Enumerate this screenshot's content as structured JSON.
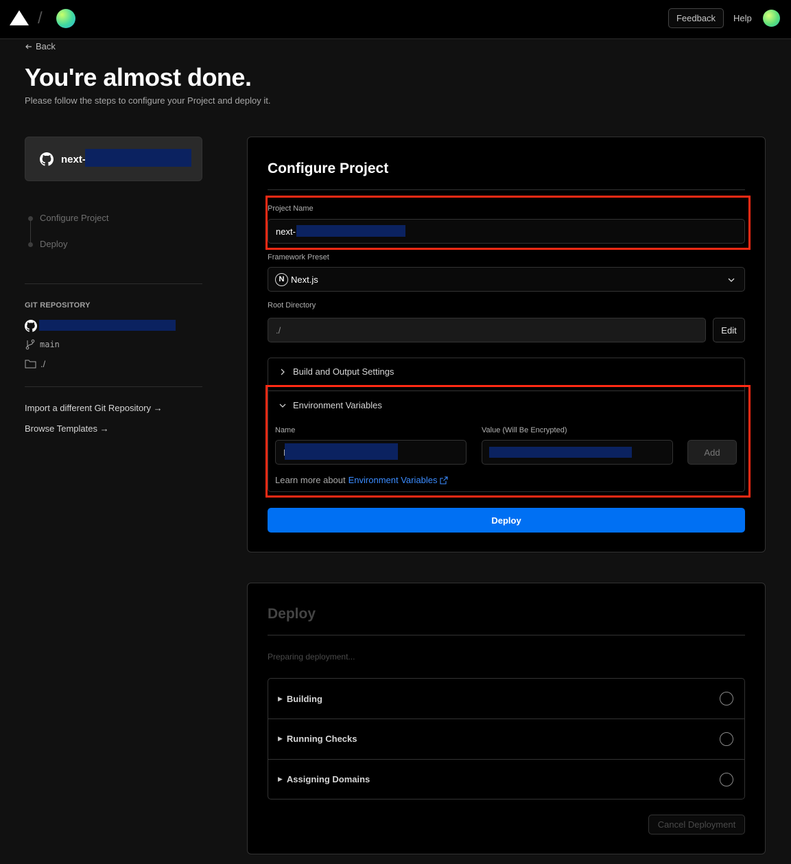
{
  "topbar": {
    "feedback_label": "Feedback",
    "help_label": "Help",
    "logo_icon": "triangle-logo-icon"
  },
  "header": {
    "back_label": "Back",
    "title": "You're almost done.",
    "subtitle": "Please follow the steps to configure your Project and deploy it."
  },
  "sidebar": {
    "repo_card_prefix": "next-",
    "steps": [
      "Configure Project",
      "Deploy"
    ],
    "git_section_label": "GIT REPOSITORY",
    "branch": "main",
    "directory": "./",
    "links": [
      "Import a different Git Repository →",
      "Browse Templates →"
    ]
  },
  "configure": {
    "title": "Configure Project",
    "project_name_label": "Project Name",
    "project_name_value": "next-",
    "framework_label": "Framework Preset",
    "framework_value": "Next.js",
    "root_dir_label": "Root Directory",
    "root_dir_value": "./",
    "edit_label": "Edit",
    "build_settings_label": "Build and Output Settings",
    "env_vars_label": "Environment Variables",
    "env_name_label": "Name",
    "env_name_value": "E",
    "env_value_label": "Value (Will Be Encrypted)",
    "add_label": "Add",
    "learn_more_text": "Learn more about",
    "learn_more_link": "Environment Variables",
    "deploy_label": "Deploy"
  },
  "deploy": {
    "title": "Deploy",
    "status": "Preparing deployment...",
    "steps": [
      "Building",
      "Running Checks",
      "Assigning Domains"
    ],
    "cancel_label": "Cancel Deployment"
  },
  "colors": {
    "accent": "#0070f3",
    "highlight": "#ff2a14",
    "link": "#3b8cff"
  }
}
